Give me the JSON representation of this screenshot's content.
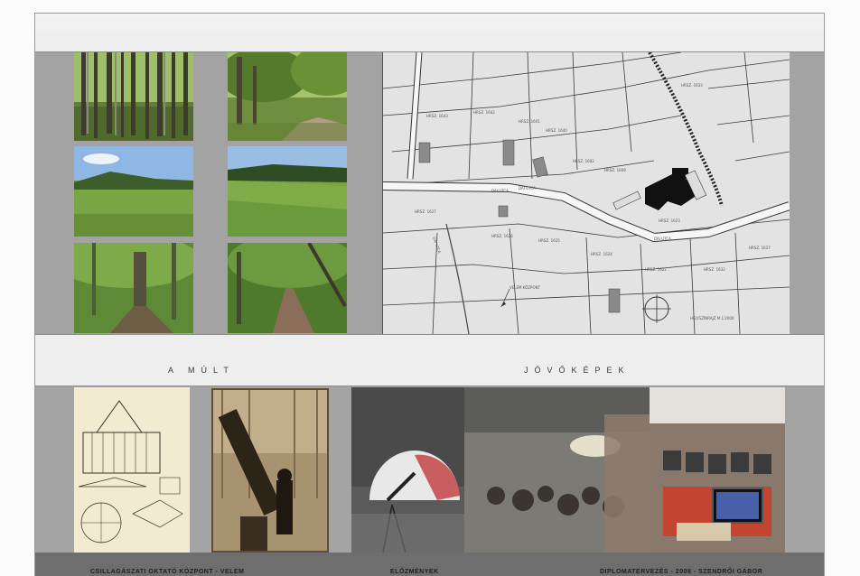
{
  "labels": {
    "past": "A MÚLT",
    "future": "JÖVŐKÉPEK"
  },
  "map": {
    "streets": [
      "DAI UTCA",
      "DAI UTCA",
      "DAI UTCA",
      "DAI UTCA"
    ],
    "lots": [
      "HRSZ. 1643",
      "HRSZ. 1642",
      "HRSZ. 1641",
      "HRSZ. 1640",
      "HRSZ. 1602",
      "HRSZ. 1609",
      "HRSZ. 1627",
      "HRSZ. 1626",
      "HRSZ. 1625",
      "HRSZ. 1624",
      "HRSZ. 1623",
      "HRSZ. 1622",
      "HRSZ. 1632",
      "HRSZ. 1633",
      "HRSZ. 1627"
    ],
    "center_label": "VELEM\nKÖZPONT",
    "scale_note": "HELYSZÍNRAJZ M 1:2000"
  },
  "footer": {
    "center": "CSILLAGÁSZATI OKTATÓ KÖZPONT - VELEM",
    "middle": "ELŐZMÉNYEK",
    "right": "DIPLOMATERVEZÉS  -  2008  -  SZENDRŐI GÁBOR"
  },
  "colors": {
    "frame_gray": "#a3a3a3",
    "footer_gray": "#6e6e6e",
    "map_bg": "#e4e4e4",
    "building": "#111111"
  }
}
